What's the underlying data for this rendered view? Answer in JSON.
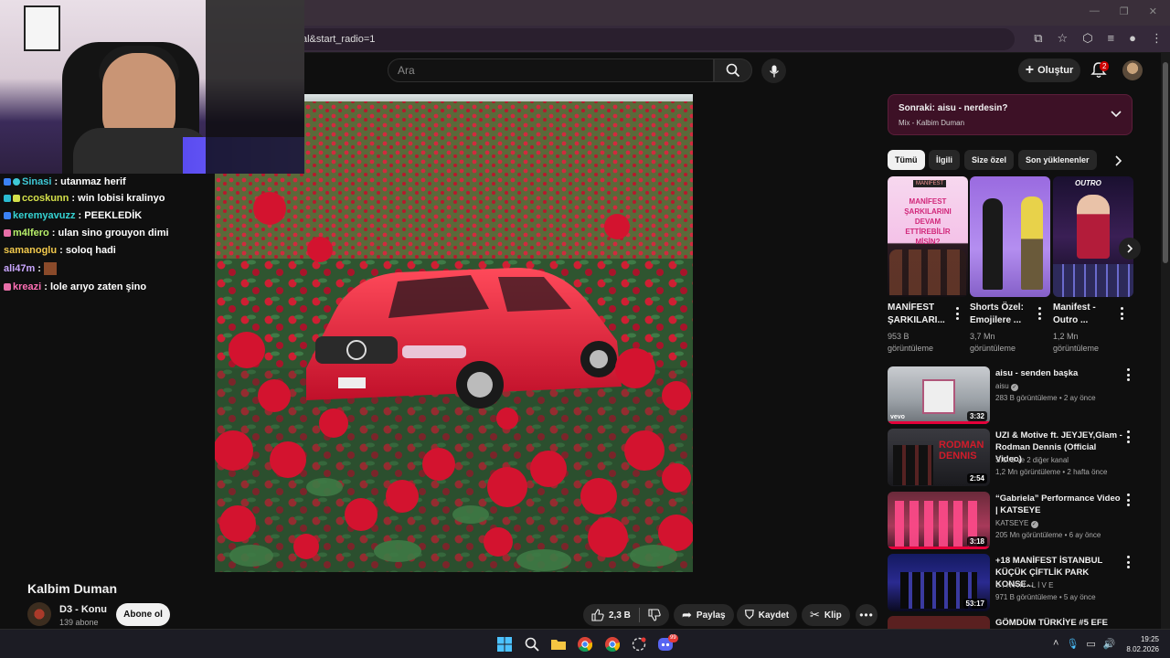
{
  "browser": {
    "url_fragment": "al&start_radio=1",
    "window_controls": [
      "—",
      "❐",
      "✕"
    ]
  },
  "header": {
    "search_placeholder": "Ara",
    "create_label": "Oluştur",
    "notification_count": "2"
  },
  "chat": [
    {
      "user": "Sinasi",
      "message": " : utanmaz herif",
      "color": "#3ec9d6",
      "badge": "#3b82f6"
    },
    {
      "user": "ccoskunn",
      "message": " : win lobisi kralinyo",
      "color": "#d4e04a",
      "badge": "#2bbbd1"
    },
    {
      "user": "keremyavuzz",
      "message": " : PEEKLEDİK",
      "color": "#35d3d3",
      "badge": "#3b82f6"
    },
    {
      "user": "m4lfero",
      "message": " : ulan sino grouyon dimi",
      "color": "#b8f06a",
      "badge": "#e86fa8"
    },
    {
      "user": "samanoglu",
      "message": " : soloq hadi",
      "color": "#f2c94c",
      "badge": ""
    },
    {
      "user": "ali47m",
      "message": " : ",
      "color": "#c9a6ff",
      "badge": ""
    },
    {
      "user": "kreazi",
      "message": " : lole arıyo zaten şino",
      "color": "#ff6fb5",
      "badge": "#e86fa8"
    }
  ],
  "video": {
    "title": "Kalbim Duman",
    "channel": "D3 - Konu",
    "subscribers": "139 abone",
    "subscribe_label": "Abone ol",
    "likes": "2,3 B",
    "share_label": "Paylaş",
    "save_label": "Kaydet",
    "clip_label": "Klip"
  },
  "next_up": {
    "title": "Sonraki: aisu - nerdesin?",
    "subtitle": "Mix - Kalbim Duman"
  },
  "chips": [
    "Tümü",
    "İlgili",
    "Size özel",
    "Son yüklenenler"
  ],
  "shorts": [
    {
      "title1": "MANİFEST",
      "title2": "ŞARKILARI...",
      "views1": "953 B",
      "views2": "görüntüleme",
      "thumb_text": "MANİFEST ŞARKILARINI DEVAM ETTİREBİLİR MİSİN?",
      "thumb_logo": "MANİFEST"
    },
    {
      "title1": "Shorts Özel:",
      "title2": "Emojilere ...",
      "views1": "3,7 Mn",
      "views2": "görüntüleme"
    },
    {
      "title1": "Manifest -",
      "title2": "Outro ...",
      "views1": "1,2 Mn",
      "views2": "görüntüleme",
      "thumb_text": "OUTRO"
    }
  ],
  "recommendations": [
    {
      "title": "aisu - senden başka",
      "channel": "aisu",
      "meta": "283 B görüntüleme • 2 ay önce",
      "duration": "3:32",
      "thumb_logo": "vevo"
    },
    {
      "title": "UZI & Motive ft. JEYJEY,Glam - Rodman Dennis (Official Video)",
      "channel": "S.O.S ve 2 diğer kanal",
      "meta": "1,2 Mn görüntüleme • 2 hafta önce",
      "duration": "2:54",
      "thumb_text": "RODMAN DENNIS"
    },
    {
      "title": "“Gabriela” Performance Video | KATSEYE",
      "channel": "KATSEYE",
      "meta": "205 Mn görüntüleme • 6 ay önce",
      "duration": "3:18"
    },
    {
      "title": "+18 MANİFEST İSTANBUL KÜÇÜK ÇİFTLİK PARK KONSE...",
      "channel": "S İ N A N • L İ V E",
      "meta": "971 B görüntüleme • 5 ay önce",
      "duration": "53:17"
    },
    {
      "title": "GÖMDÜM TÜRKİYE #5 EFE",
      "channel": "",
      "meta": "",
      "duration": ""
    }
  ],
  "taskbar": {
    "time": "19:25",
    "date": "8.02.2026",
    "discord_badge": "99"
  }
}
